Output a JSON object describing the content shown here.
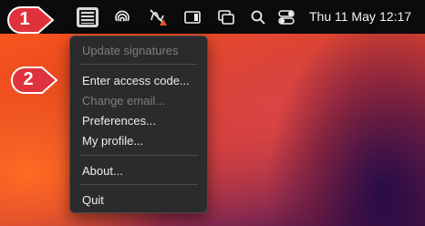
{
  "menubar": {
    "app_icon": "document-list-icon",
    "icons": [
      "fingerprint-icon",
      "signature-alert-icon",
      "window-icon",
      "screen-mirroring-icon",
      "search-icon",
      "control-center-icon"
    ],
    "date": "Thu 11 May",
    "time": "12:17"
  },
  "callouts": {
    "first": "1",
    "second": "2",
    "color": "#e0323c"
  },
  "menu": {
    "items": [
      {
        "label": "Update signatures",
        "enabled": false
      },
      {
        "label": "Enter access code...",
        "enabled": true
      },
      {
        "label": "Change email...",
        "enabled": false
      },
      {
        "label": "Preferences...",
        "enabled": true
      },
      {
        "label": "My profile...",
        "enabled": true
      },
      {
        "label": "About...",
        "enabled": true
      },
      {
        "label": "Quit",
        "enabled": true
      }
    ]
  }
}
